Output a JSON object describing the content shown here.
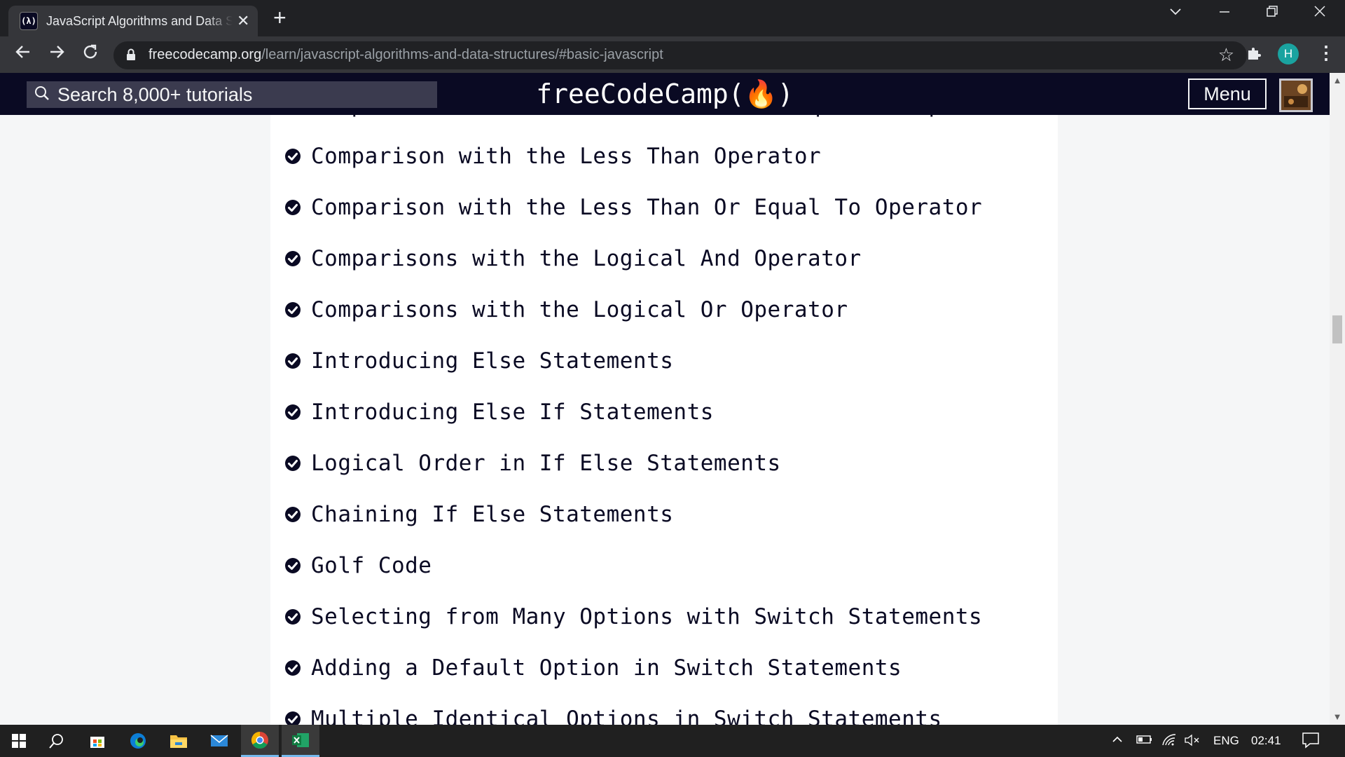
{
  "browser": {
    "tab_title": "JavaScript Algorithms and Data Structures",
    "tab_close": "✕",
    "new_tab": "+",
    "url_host": "freecodecamp.org",
    "url_path": "/learn/javascript-algorithms-and-data-structures/#basic-javascript",
    "profile_initial": "H"
  },
  "site": {
    "search_placeholder": "Search 8,000+ tutorials",
    "logo_text": "freeCodeCamp(🔥)",
    "menu_label": "Menu"
  },
  "lessons": [
    {
      "label": "Comparison with the Greater Than Or Equal To Operator",
      "completed": true
    },
    {
      "label": "Comparison with the Less Than Operator",
      "completed": true
    },
    {
      "label": "Comparison with the Less Than Or Equal To Operator",
      "completed": true
    },
    {
      "label": "Comparisons with the Logical And Operator",
      "completed": true
    },
    {
      "label": "Comparisons with the Logical Or Operator",
      "completed": true
    },
    {
      "label": "Introducing Else Statements",
      "completed": true
    },
    {
      "label": "Introducing Else If Statements",
      "completed": true
    },
    {
      "label": "Logical Order in If Else Statements",
      "completed": true
    },
    {
      "label": "Chaining If Else Statements",
      "completed": true
    },
    {
      "label": "Golf Code",
      "completed": true
    },
    {
      "label": "Selecting from Many Options with Switch Statements",
      "completed": true
    },
    {
      "label": "Adding a Default Option in Switch Statements",
      "completed": true
    },
    {
      "label": "Multiple Identical Options in Switch Statements",
      "completed": true
    }
  ],
  "taskbar": {
    "language": "ENG",
    "time": "02:41"
  },
  "colors": {
    "nav_bg": "#0a0a23",
    "page_bg": "#f5f6f7",
    "panel_bg": "#ffffff",
    "text": "#0a0a23",
    "chrome_dark": "#202124",
    "chrome_toolbar": "#35363a"
  }
}
